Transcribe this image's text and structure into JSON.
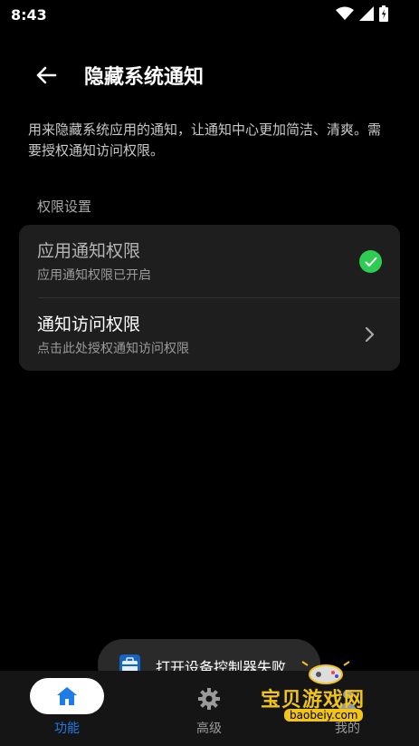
{
  "status_bar": {
    "time": "8:43"
  },
  "app_bar": {
    "title": "隐藏系统通知"
  },
  "description": "用来隐藏系统应用的通知，让通知中心更加简洁、清爽。需要授权通知访问权限。",
  "section": {
    "title": "权限设置"
  },
  "permissions": [
    {
      "title": "应用通知权限",
      "subtitle": "应用通知权限已开启",
      "state": "granted"
    },
    {
      "title": "通知访问权限",
      "subtitle": "点击此处授权通知访问权限",
      "state": "action"
    }
  ],
  "toast": {
    "text": "打开设备控制器失败"
  },
  "bottom_nav": {
    "items": [
      {
        "label": "功能",
        "icon": "home-icon",
        "active": true
      },
      {
        "label": "高级",
        "icon": "gear-icon",
        "active": false
      },
      {
        "label": "我的",
        "icon": "person-icon",
        "active": false
      }
    ]
  },
  "watermark": {
    "title": "宝贝游戏网",
    "url": "baobeiy.com"
  },
  "colors": {
    "accent": "#1e7ce8",
    "success": "#2ecc52",
    "card": "#1e1e1e"
  }
}
